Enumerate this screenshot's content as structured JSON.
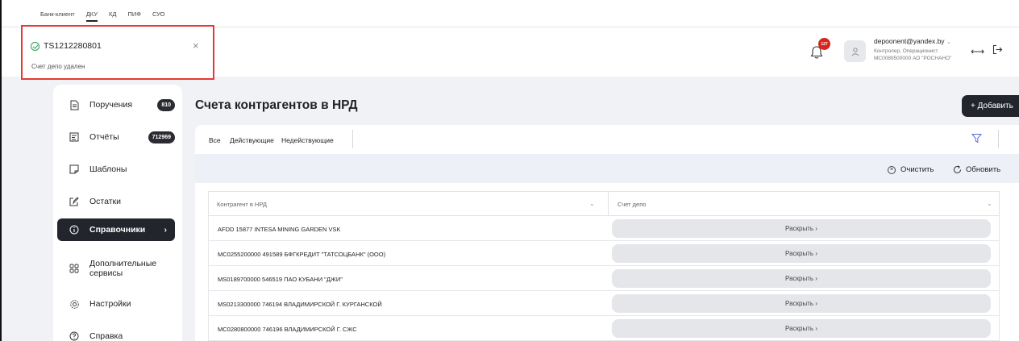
{
  "product_nav": {
    "items": [
      "Банк-клиент",
      "ДКУ",
      "КД",
      "ПИФ",
      "СУО"
    ],
    "active": "ДКУ"
  },
  "toast": {
    "title": "TS1212280801",
    "message": "Счет депо удален",
    "close": "×"
  },
  "header": {
    "notification_count": "127",
    "user_email": "depoonent@yandex.by",
    "user_roles": "Контролер, Операционист",
    "user_org": "MC0089500000 АО \"РОСНАНО\""
  },
  "sidebar": {
    "items": [
      {
        "label": "Поручения",
        "count": "810"
      },
      {
        "label": "Отчёты",
        "count": "712969"
      },
      {
        "label": "Шаблоны"
      },
      {
        "label": "Остатки"
      },
      {
        "label": "Справочники",
        "active": true
      },
      {
        "label": "Дополнительные сервисы"
      },
      {
        "label": "Настройки"
      },
      {
        "label": "Справка"
      }
    ]
  },
  "page": {
    "title": "Счета контрагентов в НРД",
    "add_label": "+ Добавить",
    "tabs": [
      "Все",
      "Действующие",
      "Недействующие"
    ],
    "clear_label": "Очистить",
    "refresh_label": "Обновить"
  },
  "table": {
    "columns": [
      "Контрагент в НРД",
      "Счет депо"
    ],
    "reveal_label": "Раскрыть  ›",
    "rows": [
      "AFDD 15877 INTESA MINING GARDEN VSK",
      "MC0255200000 491589 БФГКРЕДИТ \"ТАТСОЦБАНК\" (ООО)",
      "MS0189700000 546519 ПАО КУБАНИ \"ДЖИ\"",
      "MS0213300000 746194 ВЛАДИМИРСКОЙ Г. КУРГАНСКОЙ",
      "MC0280800000 746196 ВЛАДИМИРСКОЙ Г. СЖС"
    ]
  }
}
